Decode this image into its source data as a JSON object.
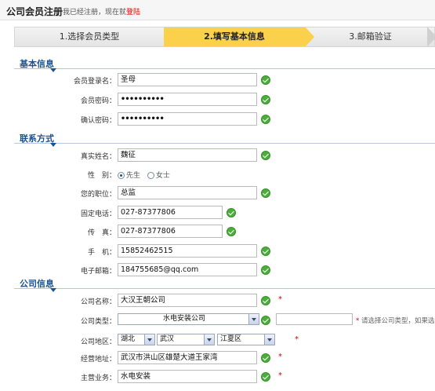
{
  "header": {
    "title": "公司会员注册",
    "hint_prefix": "我已经注册，现在就",
    "login_link": "登陆"
  },
  "steps": [
    {
      "label": "1.选择会员类型"
    },
    {
      "label": "2.填写基本信息"
    },
    {
      "label": "3.邮箱验证"
    }
  ],
  "sections": {
    "basic": "基本信息",
    "contact": "联系方式",
    "company": "公司信息"
  },
  "basic": {
    "login_label": "会员登录名：",
    "login_value": "圣母",
    "password_label": "会员密码：",
    "password_value": "••••••••••",
    "confirm_label": "确认密码：",
    "confirm_value": "••••••••••"
  },
  "contact": {
    "name_label": "真实姓名：",
    "name_value": "魏征",
    "gender_label": "性　别：",
    "gender_options": [
      "先生",
      "女士"
    ],
    "gender_selected": "先生",
    "position_label": "您的职位：",
    "position_value": "总监",
    "phone_label": "固定电话：",
    "phone_value": "027-87377806",
    "fax_label": "传　真：",
    "fax_value": "027-87377806",
    "mobile_label": "手　机：",
    "mobile_value": "15852462515",
    "email_label": "电子邮箱：",
    "email_value": "184755685@qq.com"
  },
  "company": {
    "name_label": "公司名称：",
    "name_value": "大汉王朝公司",
    "type_label": "公司类型：",
    "type_value": "水电安装公司",
    "type_note": "请选择公司类型，如果选",
    "region_label": "公司地区：",
    "province": "湖北",
    "city": "武汉",
    "district": "江夏区",
    "address_label": "经营地址：",
    "address_value": "武汉市洪山区雄楚大道王家湾",
    "business_label": "主营业务：",
    "business_value": "水电安装",
    "required_mark": "*"
  },
  "colors": {
    "accent": "#1b5391",
    "active_step": "#fbd04a",
    "ok": "#4bae3b",
    "required": "#e00000"
  }
}
